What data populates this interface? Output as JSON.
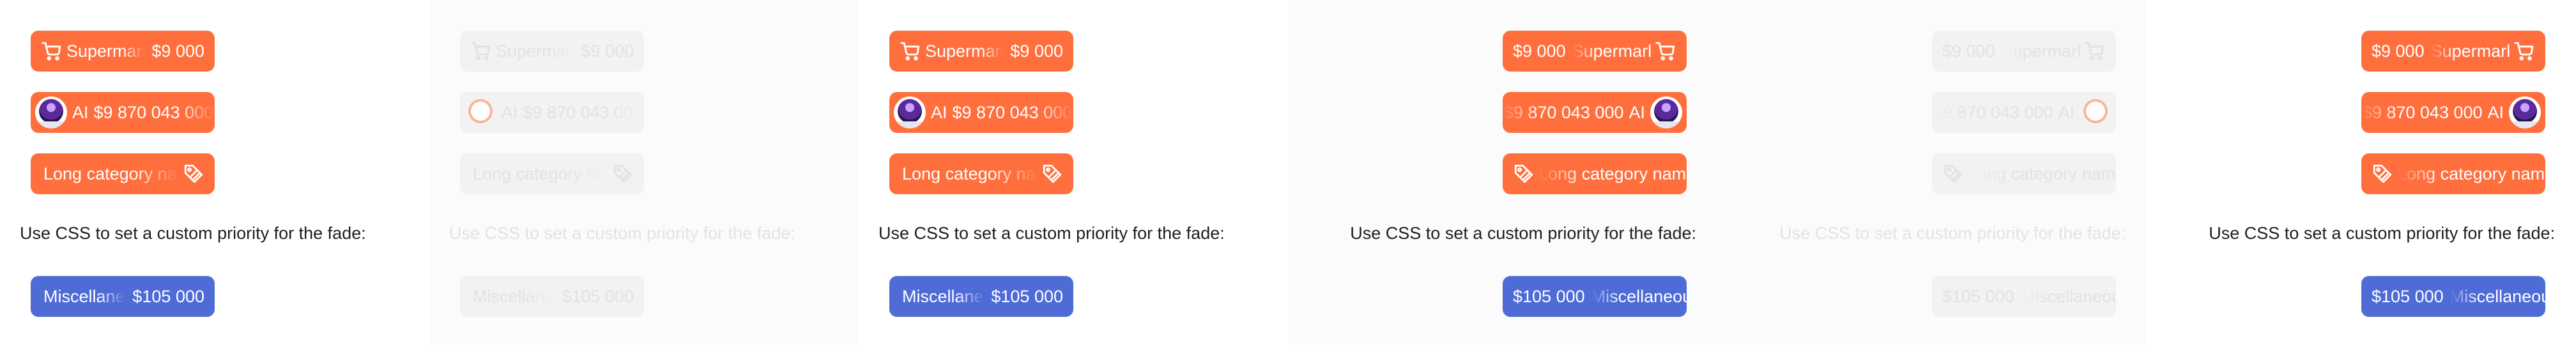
{
  "colors": {
    "accent": "#ff6f3d",
    "secondary": "#4e6bd6",
    "ghost_chip": "#f2f2f2",
    "text": "#1d1d1d"
  },
  "chips": {
    "supermarkets": {
      "label": "Supermarkets",
      "amount": "$9 000",
      "icon": "cart-icon"
    },
    "ai": {
      "label": "AI",
      "amount": "$9 870 043 000",
      "icon": "avatar"
    },
    "long_category": {
      "label": "Long category name",
      "icon": "tag-icon"
    },
    "miscellaneous": {
      "label": "Miscellaneous goods",
      "amount": "$105 000"
    }
  },
  "note": "Use CSS to set a custom priority for the fade:"
}
